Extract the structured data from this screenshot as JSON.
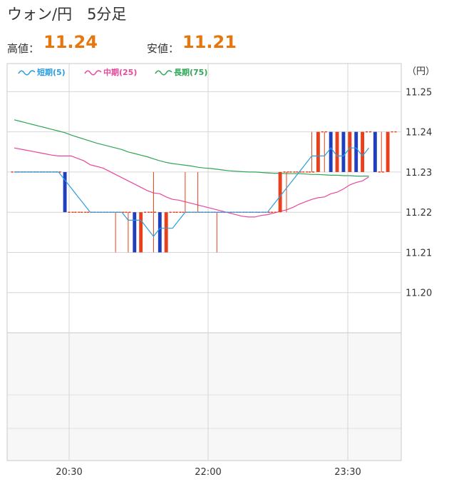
{
  "header": {
    "title": "ウォン/円　5分足",
    "high_label": "高値：",
    "high_value": "11.24",
    "low_label": "安値：",
    "low_value": "11.21"
  },
  "colors": {
    "up": "#e8401c",
    "down": "#1f3fbf",
    "short": "#2a9de0",
    "mid": "#e8479b",
    "long": "#2fa657",
    "grid": "#d6d6d6",
    "frame": "#c8c8c8",
    "value": "#e6770f"
  },
  "chart_data": {
    "type": "candlestick",
    "unit_label": "（円）",
    "y_ticks": [
      "11.25",
      "11.24",
      "11.23",
      "11.22",
      "11.21",
      "11.20"
    ],
    "ylim": [
      11.19,
      11.257
    ],
    "x_ticks": [
      "20:30",
      "22:00",
      "23:30"
    ],
    "legend": [
      {
        "label": "短期(5)",
        "key": "short"
      },
      {
        "label": "中期(25)",
        "key": "mid"
      },
      {
        "label": "長期(75)",
        "key": "long"
      }
    ],
    "candles": [
      {
        "o": 11.23,
        "h": 11.23,
        "l": 11.23,
        "c": 11.23
      },
      {
        "o": 11.23,
        "h": 11.23,
        "l": 11.23,
        "c": 11.23
      },
      {
        "o": 11.23,
        "h": 11.23,
        "l": 11.23,
        "c": 11.23
      },
      {
        "o": 11.23,
        "h": 11.23,
        "l": 11.23,
        "c": 11.23
      },
      {
        "o": 11.23,
        "h": 11.23,
        "l": 11.23,
        "c": 11.23
      },
      {
        "o": 11.23,
        "h": 11.23,
        "l": 11.23,
        "c": 11.23
      },
      {
        "o": 11.23,
        "h": 11.23,
        "l": 11.23,
        "c": 11.23
      },
      {
        "o": 11.23,
        "h": 11.23,
        "l": 11.23,
        "c": 11.23
      },
      {
        "o": 11.23,
        "h": 11.23,
        "l": 11.22,
        "c": 11.22
      },
      {
        "o": 11.22,
        "h": 11.22,
        "l": 11.22,
        "c": 11.22
      },
      {
        "o": 11.22,
        "h": 11.22,
        "l": 11.22,
        "c": 11.22
      },
      {
        "o": 11.22,
        "h": 11.22,
        "l": 11.22,
        "c": 11.22
      },
      {
        "o": 11.22,
        "h": 11.22,
        "l": 11.22,
        "c": 11.22
      },
      {
        "o": 11.22,
        "h": 11.22,
        "l": 11.22,
        "c": 11.22
      },
      {
        "o": 11.22,
        "h": 11.22,
        "l": 11.22,
        "c": 11.22
      },
      {
        "o": 11.22,
        "h": 11.22,
        "l": 11.22,
        "c": 11.22
      },
      {
        "o": 11.22,
        "h": 11.22,
        "l": 11.21,
        "c": 11.22
      },
      {
        "o": 11.22,
        "h": 11.22,
        "l": 11.22,
        "c": 11.22
      },
      {
        "o": 11.22,
        "h": 11.22,
        "l": 11.21,
        "c": 11.22
      },
      {
        "o": 11.22,
        "h": 11.22,
        "l": 11.21,
        "c": 11.21
      },
      {
        "o": 11.21,
        "h": 11.22,
        "l": 11.21,
        "c": 11.22
      },
      {
        "o": 11.22,
        "h": 11.22,
        "l": 11.22,
        "c": 11.22
      },
      {
        "o": 11.22,
        "h": 11.23,
        "l": 11.21,
        "c": 11.22
      },
      {
        "o": 11.22,
        "h": 11.22,
        "l": 11.21,
        "c": 11.21
      },
      {
        "o": 11.21,
        "h": 11.22,
        "l": 11.21,
        "c": 11.22
      },
      {
        "o": 11.22,
        "h": 11.22,
        "l": 11.22,
        "c": 11.22
      },
      {
        "o": 11.22,
        "h": 11.22,
        "l": 11.22,
        "c": 11.22
      },
      {
        "o": 11.22,
        "h": 11.23,
        "l": 11.22,
        "c": 11.22
      },
      {
        "o": 11.22,
        "h": 11.22,
        "l": 11.22,
        "c": 11.22
      },
      {
        "o": 11.22,
        "h": 11.23,
        "l": 11.22,
        "c": 11.22
      },
      {
        "o": 11.22,
        "h": 11.22,
        "l": 11.22,
        "c": 11.22
      },
      {
        "o": 11.22,
        "h": 11.22,
        "l": 11.22,
        "c": 11.22
      },
      {
        "o": 11.22,
        "h": 11.22,
        "l": 11.21,
        "c": 11.22
      },
      {
        "o": 11.22,
        "h": 11.22,
        "l": 11.22,
        "c": 11.22
      },
      {
        "o": 11.22,
        "h": 11.22,
        "l": 11.22,
        "c": 11.22
      },
      {
        "o": 11.22,
        "h": 11.22,
        "l": 11.22,
        "c": 11.22
      },
      {
        "o": 11.22,
        "h": 11.22,
        "l": 11.22,
        "c": 11.22
      },
      {
        "o": 11.22,
        "h": 11.22,
        "l": 11.22,
        "c": 11.22
      },
      {
        "o": 11.22,
        "h": 11.22,
        "l": 11.22,
        "c": 11.22
      },
      {
        "o": 11.22,
        "h": 11.22,
        "l": 11.22,
        "c": 11.22
      },
      {
        "o": 11.22,
        "h": 11.22,
        "l": 11.22,
        "c": 11.22
      },
      {
        "o": 11.22,
        "h": 11.22,
        "l": 11.22,
        "c": 11.22
      },
      {
        "o": 11.22,
        "h": 11.23,
        "l": 11.22,
        "c": 11.23
      },
      {
        "o": 11.23,
        "h": 11.23,
        "l": 11.22,
        "c": 11.23
      },
      {
        "o": 11.23,
        "h": 11.23,
        "l": 11.23,
        "c": 11.23
      },
      {
        "o": 11.23,
        "h": 11.23,
        "l": 11.23,
        "c": 11.23
      },
      {
        "o": 11.23,
        "h": 11.23,
        "l": 11.23,
        "c": 11.23
      },
      {
        "o": 11.23,
        "h": 11.24,
        "l": 11.23,
        "c": 11.23
      },
      {
        "o": 11.23,
        "h": 11.24,
        "l": 11.23,
        "c": 11.24
      },
      {
        "o": 11.24,
        "h": 11.24,
        "l": 11.23,
        "c": 11.24
      },
      {
        "o": 11.24,
        "h": 11.24,
        "l": 11.23,
        "c": 11.23
      },
      {
        "o": 11.23,
        "h": 11.24,
        "l": 11.23,
        "c": 11.24
      },
      {
        "o": 11.24,
        "h": 11.24,
        "l": 11.23,
        "c": 11.23
      },
      {
        "o": 11.23,
        "h": 11.24,
        "l": 11.23,
        "c": 11.24
      },
      {
        "o": 11.24,
        "h": 11.24,
        "l": 11.23,
        "c": 11.23
      },
      {
        "o": 11.23,
        "h": 11.24,
        "l": 11.23,
        "c": 11.24
      },
      {
        "o": 11.24,
        "h": 11.24,
        "l": 11.24,
        "c": 11.24
      },
      {
        "o": 11.24,
        "h": 11.24,
        "l": 11.23,
        "c": 11.23
      },
      {
        "o": 11.23,
        "h": 11.24,
        "l": 11.23,
        "c": 11.23
      },
      {
        "o": 11.23,
        "h": 11.24,
        "l": 11.23,
        "c": 11.24
      },
      {
        "o": 11.24,
        "h": 11.24,
        "l": 11.24,
        "c": 11.24
      }
    ],
    "ma_short": [
      11.23,
      11.23,
      11.23,
      11.23,
      11.23,
      11.23,
      11.23,
      11.23,
      11.228,
      11.226,
      11.224,
      11.222,
      11.22,
      11.22,
      11.22,
      11.22,
      11.22,
      11.22,
      11.218,
      11.218,
      11.218,
      11.216,
      11.214,
      11.216,
      11.216,
      11.216,
      11.218,
      11.22,
      11.22,
      11.22,
      11.22,
      11.22,
      11.22,
      11.22,
      11.22,
      11.22,
      11.22,
      11.22,
      11.22,
      11.22,
      11.22,
      11.222,
      11.224,
      11.226,
      11.228,
      11.23,
      11.232,
      11.234,
      11.234,
      11.234,
      11.236,
      11.234,
      11.234,
      11.236,
      11.236,
      11.234,
      11.236
    ],
    "ma_mid": [
      11.236,
      11.2357,
      11.2354,
      11.2351,
      11.2348,
      11.2345,
      11.2342,
      11.234,
      11.234,
      11.234,
      11.2334,
      11.2328,
      11.2318,
      11.2314,
      11.231,
      11.2302,
      11.2294,
      11.2286,
      11.2278,
      11.227,
      11.2262,
      11.2254,
      11.2248,
      11.2246,
      11.2238,
      11.2232,
      11.223,
      11.2226,
      11.2222,
      11.2218,
      11.2214,
      11.221,
      11.2206,
      11.2202,
      11.2198,
      11.2194,
      11.219,
      11.2188,
      11.2188,
      11.2192,
      11.2194,
      11.2198,
      11.2202,
      11.2206,
      11.2212,
      11.222,
      11.2226,
      11.2232,
      11.2236,
      11.2238,
      11.2246,
      11.225,
      11.2258,
      11.2268,
      11.2274,
      11.2278,
      11.2288
    ],
    "ma_long": [
      11.243,
      11.2426,
      11.2422,
      11.2418,
      11.2414,
      11.241,
      11.2406,
      11.2402,
      11.2398,
      11.2392,
      11.2387,
      11.2382,
      11.2377,
      11.2372,
      11.2368,
      11.2364,
      11.236,
      11.2356,
      11.235,
      11.2346,
      11.2342,
      11.2338,
      11.2333,
      11.2328,
      11.2324,
      11.2321,
      11.2319,
      11.2317,
      11.2315,
      11.2312,
      11.231,
      11.2309,
      11.2307,
      11.2305,
      11.2303,
      11.2302,
      11.2301,
      11.23,
      11.23,
      11.2299,
      11.2298,
      11.2297,
      11.2297,
      11.2296,
      11.2296,
      11.2296,
      11.2295,
      11.2294,
      11.2294,
      11.2293,
      11.2292,
      11.2292,
      11.2291,
      11.2291,
      11.229,
      11.229,
      11.229
    ]
  }
}
